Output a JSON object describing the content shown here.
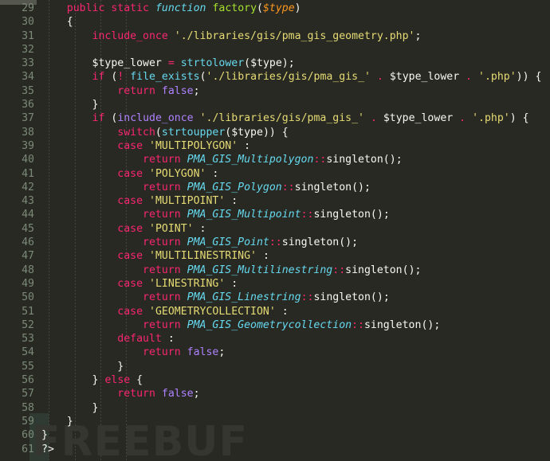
{
  "editor": {
    "theme_name": "monokai-dark",
    "background_color": "#282923",
    "gutter_text_color": "#7b8a77",
    "default_text_color": "#f8f8f2",
    "font_size_px": 13,
    "line_height_px": 17,
    "first_line_number": 29,
    "last_line_number": 61,
    "language": "PHP",
    "watermark": "FREEBUF",
    "watermark_color": "#35362f"
  },
  "palette": {
    "keyword": "#f92672",
    "constant": "#ae81ff",
    "function_name": "#a6e22e",
    "builtin_call": "#66d9ef",
    "class_name": "#66d9ef",
    "string": "#e6db74",
    "parameter": "#fd971f",
    "plain": "#f8f8f2",
    "gutter_tint": "#2f3a32",
    "indent_guide": "#4a4b43"
  },
  "code": {
    "lines": [
      {
        "n": 29,
        "text": "    public static function factory($type)"
      },
      {
        "n": 30,
        "text": "    {"
      },
      {
        "n": 31,
        "text": "        include_once './libraries/gis/pma_gis_geometry.php';"
      },
      {
        "n": 32,
        "text": ""
      },
      {
        "n": 33,
        "text": "        $type_lower = strtolower($type);"
      },
      {
        "n": 34,
        "text": "        if (! file_exists('./libraries/gis/pma_gis_' . $type_lower . '.php')) {"
      },
      {
        "n": 35,
        "text": "            return false;"
      },
      {
        "n": 36,
        "text": "        }"
      },
      {
        "n": 37,
        "text": "        if (include_once './libraries/gis/pma_gis_' . $type_lower . '.php') {"
      },
      {
        "n": 38,
        "text": "            switch(strtoupper($type)) {"
      },
      {
        "n": 39,
        "text": "            case 'MULTIPOLYGON' :"
      },
      {
        "n": 40,
        "text": "                return PMA_GIS_Multipolygon::singleton();"
      },
      {
        "n": 41,
        "text": "            case 'POLYGON' :"
      },
      {
        "n": 42,
        "text": "                return PMA_GIS_Polygon::singleton();"
      },
      {
        "n": 43,
        "text": "            case 'MULTIPOINT' :"
      },
      {
        "n": 44,
        "text": "                return PMA_GIS_Multipoint::singleton();"
      },
      {
        "n": 45,
        "text": "            case 'POINT' :"
      },
      {
        "n": 46,
        "text": "                return PMA_GIS_Point::singleton();"
      },
      {
        "n": 47,
        "text": "            case 'MULTILINESTRING' :"
      },
      {
        "n": 48,
        "text": "                return PMA_GIS_Multilinestring::singleton();"
      },
      {
        "n": 49,
        "text": "            case 'LINESTRING' :"
      },
      {
        "n": 50,
        "text": "                return PMA_GIS_Linestring::singleton();"
      },
      {
        "n": 51,
        "text": "            case 'GEOMETRYCOLLECTION' :"
      },
      {
        "n": 52,
        "text": "                return PMA_GIS_Geometrycollection::singleton();"
      },
      {
        "n": 53,
        "text": "            default :"
      },
      {
        "n": 54,
        "text": "                return false;"
      },
      {
        "n": 55,
        "text": "            }"
      },
      {
        "n": 56,
        "text": "        } else {"
      },
      {
        "n": 57,
        "text": "            return false;"
      },
      {
        "n": 58,
        "text": "        }"
      },
      {
        "n": 59,
        "text": "    }"
      },
      {
        "n": 60,
        "text": "}"
      },
      {
        "n": 61,
        "text": "?>"
      }
    ]
  }
}
